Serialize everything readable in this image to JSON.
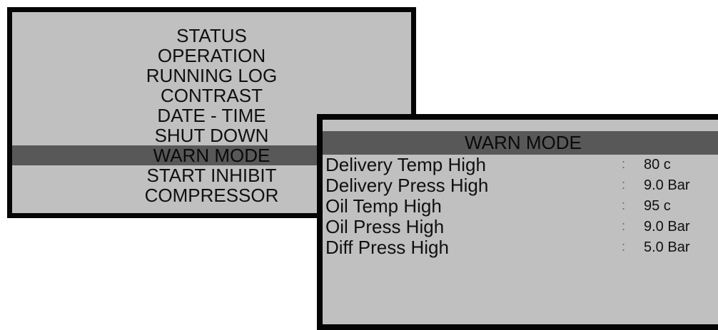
{
  "main_menu": {
    "items": [
      {
        "label": "STATUS",
        "selected": false
      },
      {
        "label": "OPERATION",
        "selected": false
      },
      {
        "label": "RUNNING LOG",
        "selected": false
      },
      {
        "label": "CONTRAST",
        "selected": false
      },
      {
        "label": "DATE - TIME",
        "selected": false
      },
      {
        "label": "SHUT DOWN",
        "selected": false
      },
      {
        "label": "WARN MODE",
        "selected": true
      },
      {
        "label": "START INHIBIT",
        "selected": false
      },
      {
        "label": "COMPRESSOR",
        "selected": false
      }
    ]
  },
  "warn_mode": {
    "title": "WARN MODE",
    "rows": [
      {
        "label": "Delivery Temp High",
        "separator": ":",
        "value": "80 c"
      },
      {
        "label": "Delivery Press High",
        "separator": ":",
        "value": "9.0 Bar"
      },
      {
        "label": "Oil Temp High",
        "separator": ":",
        "value": "95 c"
      },
      {
        "label": "Oil Press High",
        "separator": ":",
        "value": "9.0 Bar"
      },
      {
        "label": "Diff Press High",
        "separator": ":",
        "value": "5.0 Bar"
      }
    ]
  },
  "colors": {
    "screen_background": "#c0c0c0",
    "highlight_bar": "#585858",
    "bezel": "#050505"
  }
}
